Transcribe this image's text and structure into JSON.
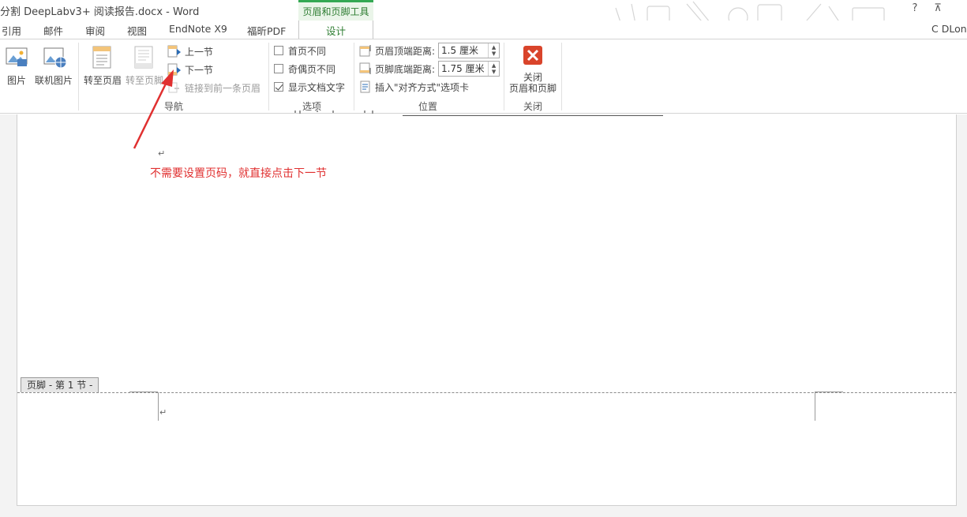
{
  "window": {
    "title": "分割 DeepLabv3+ 阅读报告.docx - Word",
    "tool_context": "页眉和页脚工具",
    "help": "?",
    "restore": "⊼"
  },
  "tabs": {
    "items": [
      "引用",
      "邮件",
      "审阅",
      "视图",
      "EndNote X9",
      "福昕PDF"
    ],
    "active": "设计",
    "user": "C DLonr"
  },
  "ribbon": {
    "insert": {
      "picture": "图片",
      "online_picture": "联机图片"
    },
    "navigation": {
      "goto_header": "转至页眉",
      "goto_footer": "转至页脚",
      "previous": "上一节",
      "next": "下一节",
      "link_previous": "链接到前一条页眉",
      "label": "导航"
    },
    "options": {
      "first_page": "首页不同",
      "odd_even": "奇偶页不同",
      "show_text": "显示文档文字",
      "label": "选项",
      "first_page_checked": false,
      "odd_even_checked": false,
      "show_text_checked": true
    },
    "position": {
      "header_top_label": "页眉顶端距离:",
      "header_top_value": "1.5 厘米",
      "footer_bottom_label": "页脚底端距离:",
      "footer_bottom_value": "1.75 厘米",
      "insert_align_tab": "插入\"对齐方式\"选项卡",
      "label": "位置"
    },
    "close": {
      "line1": "关闭",
      "line2": "页眉和页脚",
      "label": "关闭"
    }
  },
  "document": {
    "annotation": "不需要设置页码，就直接点击下一节",
    "paragraph_mark": "↵",
    "footer_tag": "页脚 - 第 1 节 -"
  },
  "colors": {
    "accent_green": "#2e7d32",
    "annotation_red": "#e03030",
    "close_red": "#d9442b"
  }
}
